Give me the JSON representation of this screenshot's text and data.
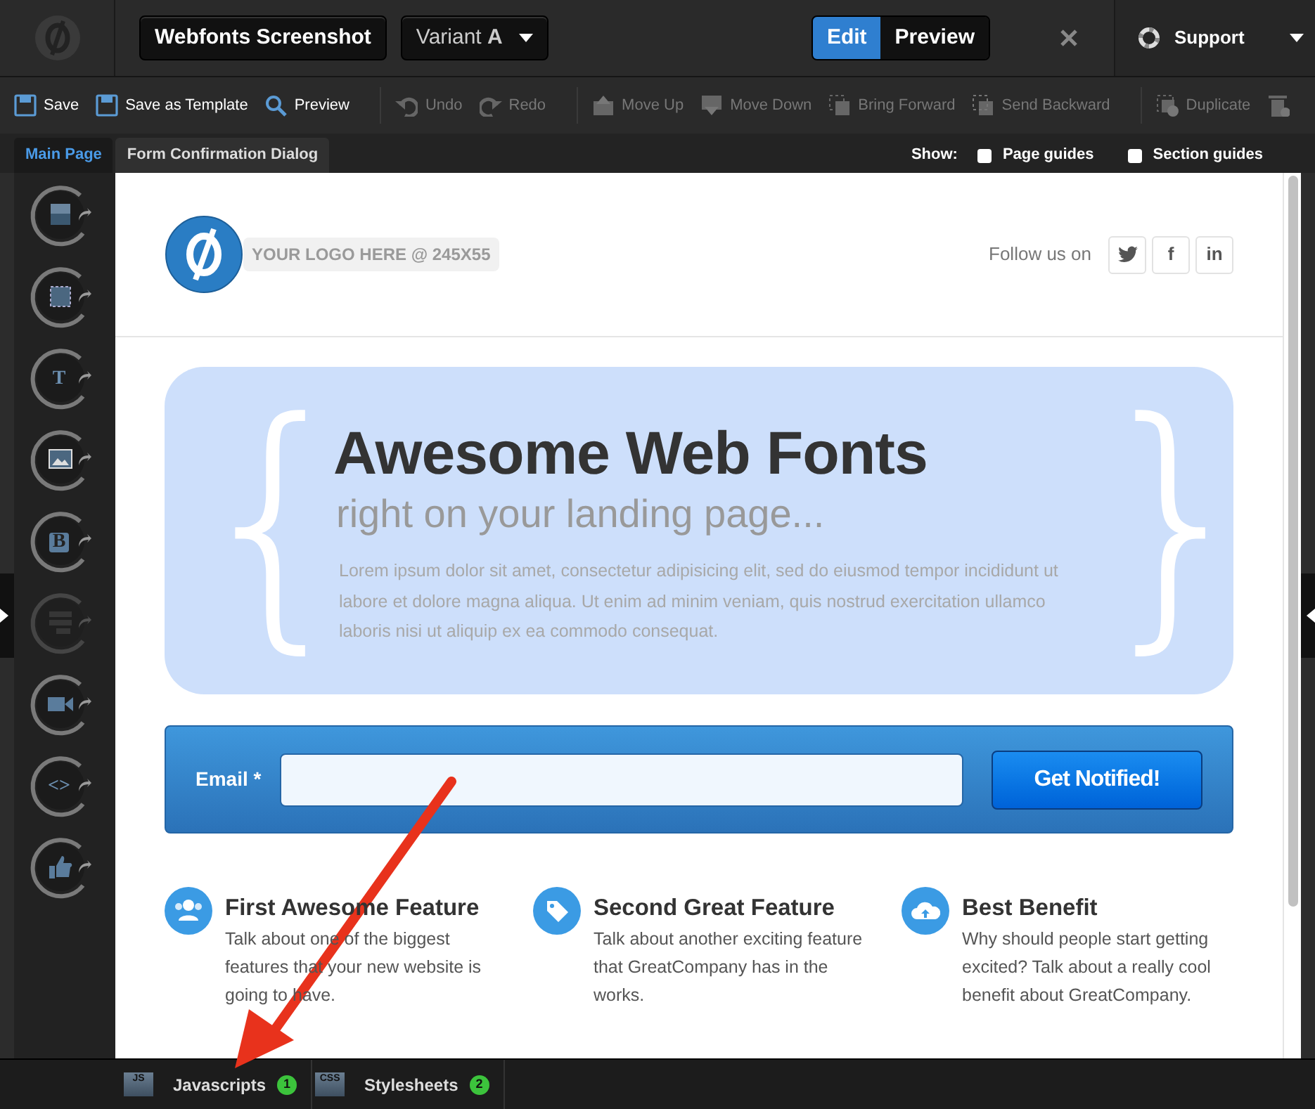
{
  "top_bar": {
    "page_name": "Webfonts Screenshot",
    "variant": "Variant **A**",
    "modes": [
      {
        "label": "Edit",
        "selected": true
      },
      {
        "label": "Preview",
        "selected": false
      }
    ],
    "support": "Support"
  },
  "toolbar_groups": [
    [
      {
        "kind": "save",
        "label": "Save",
        "disabled": false
      },
      {
        "kind": "template",
        "label": "Save as Template",
        "disabled": false
      },
      {
        "kind": "preview",
        "label": "Preview",
        "disabled": false
      }
    ],
    [
      {
        "kind": "undo",
        "label": "Undo",
        "disabled": true
      },
      {
        "kind": "redo",
        "label": "Redo",
        "disabled": true
      }
    ],
    [
      {
        "kind": "up",
        "label": "Move Up",
        "disabled": true
      },
      {
        "kind": "down",
        "label": "Move Down",
        "disabled": true
      },
      {
        "kind": "forward",
        "label": "Bring Forward",
        "disabled": true
      },
      {
        "kind": "backward",
        "label": "Send Backward",
        "disabled": true
      }
    ],
    [
      {
        "kind": "duplicate",
        "label": "Duplicate",
        "disabled": true
      },
      {
        "kind": "trash",
        "disabled": true
      }
    ]
  ],
  "page_tabs": [
    {
      "label": "Main Page",
      "selected": true
    },
    {
      "label": "Form Confirmation Dialog",
      "selected": false
    }
  ],
  "show": {
    "label": "Show:",
    "options": [
      {
        "label": "Page guides",
        "checked": false
      },
      {
        "label": "Section guides",
        "checked": false
      }
    ]
  },
  "tools": [
    {
      "kind": "section",
      "disabled": false
    },
    {
      "kind": "box",
      "disabled": false
    },
    {
      "kind": "text",
      "glyph": "T",
      "disabled": false
    },
    {
      "kind": "image",
      "disabled": false
    },
    {
      "kind": "button",
      "glyph": "B",
      "disabled": false
    },
    {
      "kind": "form",
      "disabled": true
    },
    {
      "kind": "video",
      "disabled": false
    },
    {
      "kind": "html",
      "glyph": "<>",
      "disabled": false
    },
    {
      "kind": "social",
      "disabled": false
    }
  ],
  "canvas": {
    "header": {
      "logo_placeholder": "YOUR LOGO HERE @ 245X55",
      "follow": "Follow us on",
      "social": [
        {
          "kind": "twitter"
        },
        {
          "kind": "facebook",
          "glyph": "f"
        },
        {
          "kind": "linkedin",
          "glyph": "in"
        }
      ]
    },
    "hero": {
      "open_brace": "{",
      "close_brace": "}",
      "title": "Awesome Web Fonts",
      "subtitle": "right on your landing page...",
      "body": "Lorem ipsum dolor sit amet, consectetur adipisicing elit, sed do eiusmod tempor incididunt ut labore et dolore magna aliqua. Ut enim ad minim veniam, quis nostrud exercitation ullamco laboris nisi ut aliquip ex ea commodo consequat."
    },
    "form": {
      "label": "Email *",
      "button": "Get Notified!"
    },
    "features": [
      {
        "kind": "people",
        "title": "First Awesome Feature",
        "text": "Talk about one of the biggest features that your new website is going to have."
      },
      {
        "kind": "tag",
        "title": "Second Great Feature",
        "text": "Talk about another exciting feature that GreatCompany has in the works."
      },
      {
        "kind": "cloud",
        "title": "Best Benefit",
        "text": "Why should people start getting excited? Talk about a really cool benefit about GreatCompany."
      }
    ]
  },
  "bottom_bar": [
    {
      "badge": "JS",
      "label": "Javascripts",
      "count": "1"
    },
    {
      "badge": "CSS",
      "label": "Stylesheets",
      "count": "2"
    }
  ]
}
